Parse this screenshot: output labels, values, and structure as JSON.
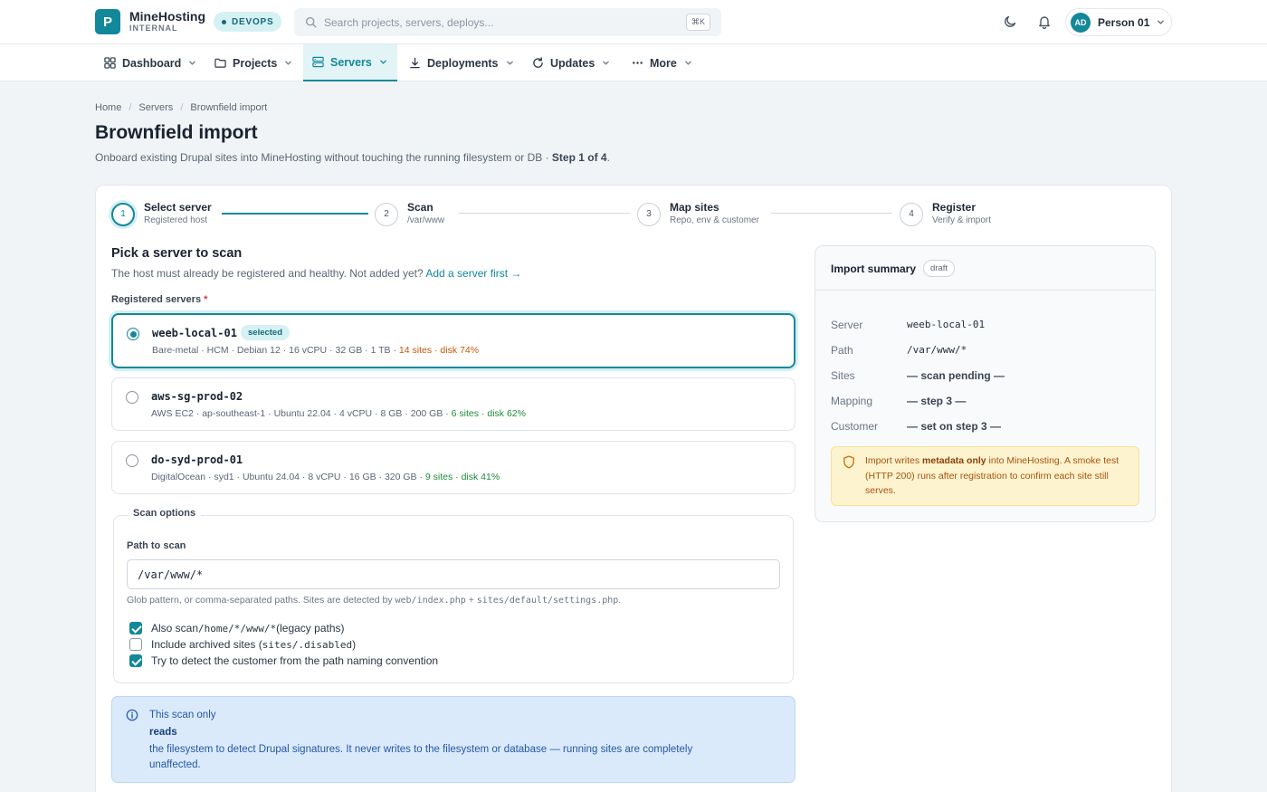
{
  "app": {
    "logo_letter": "P",
    "brand_name": "MineHosting",
    "brand_sub": "INTERNAL",
    "env_badge": "DEVOPS"
  },
  "search": {
    "placeholder": "Search projects, servers, deploys...",
    "shortcut": "⌘K"
  },
  "user": {
    "initials": "AD",
    "name": "Person 01"
  },
  "nav": {
    "items": [
      {
        "label": "Dashboard",
        "icon": "grid-icon"
      },
      {
        "label": "Projects",
        "icon": "folder-icon"
      },
      {
        "label": "Servers",
        "icon": "server-icon",
        "active": true
      },
      {
        "label": "Deployments",
        "icon": "download-icon"
      },
      {
        "label": "Updates",
        "icon": "refresh-icon"
      },
      {
        "label": "More",
        "icon": "dots-icon"
      }
    ]
  },
  "breadcrumb": [
    "Home",
    "Servers",
    "Brownfield import"
  ],
  "page": {
    "title": "Brownfield import",
    "subtitle": "Onboard existing Drupal sites into MineHosting without touching the running filesystem or DB · ",
    "step_text": "Step 1 of 4",
    "subtitle_end": "."
  },
  "stepper": [
    {
      "num": "1",
      "title": "Select server",
      "desc": "Registered host",
      "active": true
    },
    {
      "num": "2",
      "title": "Scan",
      "desc": "/var/www"
    },
    {
      "num": "3",
      "title": "Map sites",
      "desc": "Repo, env & customer"
    },
    {
      "num": "4",
      "title": "Register",
      "desc": "Verify & import"
    }
  ],
  "pick": {
    "title": "Pick a server to scan",
    "sub": "The host must already be registered and healthy. Not added yet? ",
    "link": "Add a server first →",
    "label": "Registered servers",
    "required_mark": "*"
  },
  "servers": [
    {
      "name": "weeb-local-01",
      "badge": "selected",
      "meta": "Bare-metal · HCM · Debian 12 · 16 vCPU · 32 GB · 1 TB · ",
      "sites": "14 sites",
      "disk": "disk 74%",
      "status": "warn",
      "selected": true
    },
    {
      "name": "aws-sg-prod-02",
      "meta": "AWS EC2 · ap-southeast-1 · Ubuntu 22.04 · 4 vCPU · 8 GB · 200 GB · ",
      "sites": "6 sites",
      "disk": "disk 62%",
      "status": "ok"
    },
    {
      "name": "do-syd-prod-01",
      "meta": "DigitalOcean · syd1 · Ubuntu 24.04 · 8 vCPU · 16 GB · 320 GB · ",
      "sites": "9 sites",
      "disk": "disk 41%",
      "status": "ok"
    }
  ],
  "scan_options": {
    "legend": "Scan options",
    "path_label": "Path to scan",
    "path_value": "/var/www/*",
    "help_pre": "Glob pattern, or comma-separated paths. Sites are detected by ",
    "help_code1": "web/index.php",
    "help_mid": " + ",
    "help_code2": "sites/default/settings.php",
    "help_end": ".",
    "checks": [
      {
        "pre": "Also scan ",
        "code": "/home/*/www/*",
        "post": " (legacy paths)",
        "checked": true
      },
      {
        "pre": "Include archived sites (",
        "code": "sites/.disabled",
        "post": ")",
        "checked": false
      },
      {
        "pre": "Try to detect the customer from the path naming convention",
        "code": "",
        "post": "",
        "checked": true
      }
    ]
  },
  "info": {
    "line1": "This scan only",
    "line2": "reads",
    "line3": "the filesystem to detect Drupal signatures. It never writes to the filesystem or database — running sites are completely",
    "line4": "unaffected."
  },
  "summary": {
    "title": "Import summary",
    "badge": "draft",
    "rows": [
      {
        "key": "Server",
        "value": "weeb-local-01",
        "kind": "mono"
      },
      {
        "key": "Path",
        "value": "/var/www/*",
        "kind": "mono"
      },
      {
        "key": "Sites",
        "value": "— scan pending —",
        "kind": "pending"
      },
      {
        "key": "Mapping",
        "value": "— step 3 —",
        "kind": "pending"
      },
      {
        "key": "Customer",
        "value": "— set on step 3 —",
        "kind": "pending"
      }
    ],
    "warn_pre": "Import writes ",
    "warn_bold": "metadata only",
    "warn_post": " into MineHosting. A smoke test (HTTP 200) runs after registration to confirm each site still serves."
  },
  "colors": {
    "accent": "#12889a",
    "warn": "#c5570b",
    "ok": "#1c8a3a",
    "info_bg": "#dbeafb",
    "note_bg": "#fdf3cf"
  }
}
